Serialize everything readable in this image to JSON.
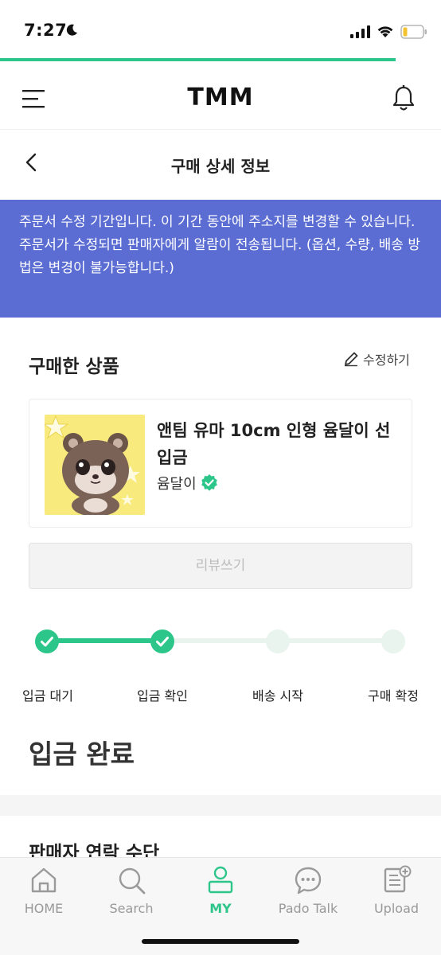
{
  "status_bar": {
    "time": "7:27"
  },
  "header": {
    "logo": "TMM"
  },
  "title_bar": {
    "title": "구매 상세 정보"
  },
  "banner": {
    "line1": "주문서 수정 기간입니다. 이 기간 동안에 주소지를 변경할 수 있습니다.",
    "line2": "주문서가 수정되면 판매자에게 알람이 전송됩니다. (옵션, 수량, 배송 방법은 변경이 불가능합니다.)"
  },
  "purchased": {
    "heading": "구매한 상품",
    "edit_label": "수정하기",
    "product": {
      "name": "앤팀 유마 10cm 인형 윰달이 선입금",
      "seller": "윰달이"
    },
    "review_button": "리뷰쓰기"
  },
  "steps": [
    {
      "label": "입금 대기",
      "status": "done"
    },
    {
      "label": "입금 확인",
      "status": "done"
    },
    {
      "label": "배송 시작",
      "status": "pending"
    },
    {
      "label": "구매 확정",
      "status": "pending"
    }
  ],
  "current_status": "입금 완료",
  "contact": {
    "heading": "판매자 연락 수단"
  },
  "bottom_nav": {
    "items": [
      {
        "label": "HOME"
      },
      {
        "label": "Search"
      },
      {
        "label": "MY"
      },
      {
        "label": "Pado Talk"
      },
      {
        "label": "Upload"
      }
    ],
    "active": "MY"
  },
  "colors": {
    "accent": "#2cc68a",
    "banner": "#5b6dd2"
  }
}
